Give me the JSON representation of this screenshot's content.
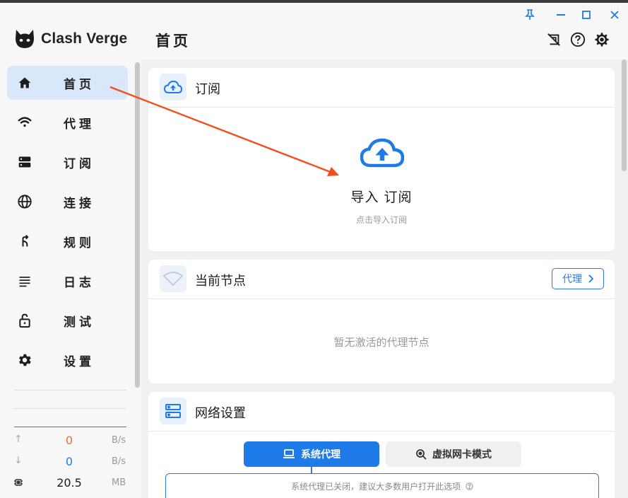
{
  "app": {
    "name": "Clash Verge"
  },
  "page": {
    "title": "首页"
  },
  "sidebar": {
    "items": [
      {
        "label": "首页",
        "icon": "home-icon",
        "active": true
      },
      {
        "label": "代理",
        "icon": "wifi-icon",
        "active": false
      },
      {
        "label": "订阅",
        "icon": "storage-icon",
        "active": false
      },
      {
        "label": "连接",
        "icon": "globe-icon",
        "active": false
      },
      {
        "label": "规则",
        "icon": "fork-icon",
        "active": false
      },
      {
        "label": "日志",
        "icon": "list-icon",
        "active": false
      },
      {
        "label": "测试",
        "icon": "lock-open-icon",
        "active": false
      },
      {
        "label": "设置",
        "icon": "gear-icon",
        "active": false
      }
    ]
  },
  "traffic": {
    "upload": {
      "value": "0",
      "unit": "B/s",
      "color": "#f26b3a"
    },
    "download": {
      "value": "0",
      "unit": "B/s",
      "color": "#1e7ae6"
    },
    "memory": {
      "value": "20.5",
      "unit": "MB"
    }
  },
  "cards": {
    "subscription": {
      "title": "订阅",
      "import_title": "导入 订阅",
      "import_subtitle": "点击导入订阅"
    },
    "current_node": {
      "title": "当前节点",
      "proxy_button": "代理",
      "empty_message": "暂无激活的代理节点"
    },
    "network": {
      "title": "网络设置",
      "modes": [
        {
          "label": "系统代理",
          "active": true
        },
        {
          "label": "虚拟网卡模式",
          "active": false
        }
      ],
      "hint": "系统代理已关闭，建议大多数用户打开此选项"
    }
  },
  "colors": {
    "accent": "#1e7ae6",
    "annotation_arrow": "#f24e1e"
  }
}
